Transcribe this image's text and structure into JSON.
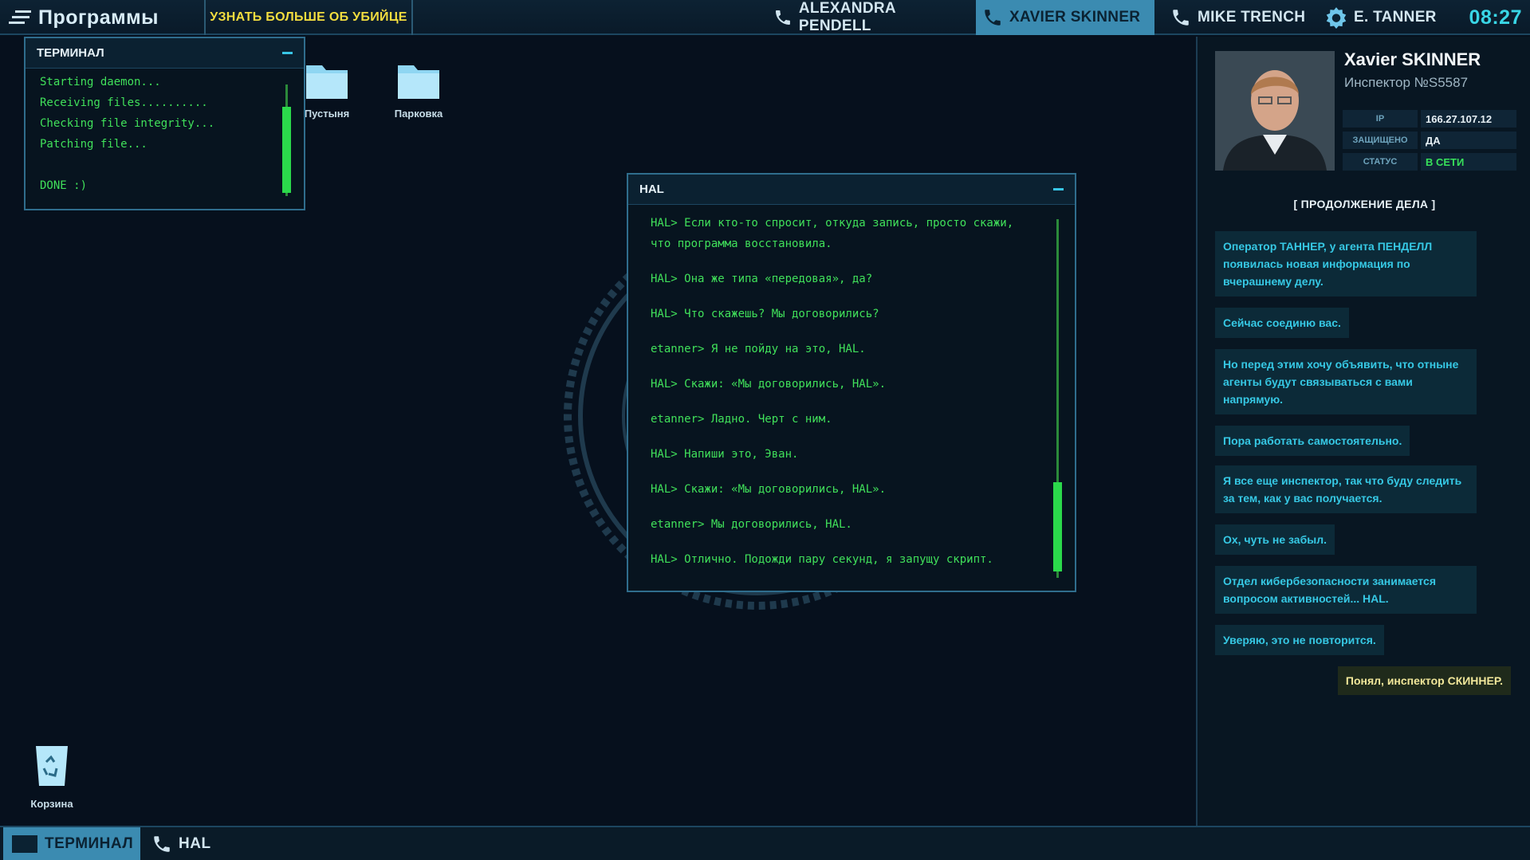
{
  "topbar": {
    "programs_label": "Программы",
    "learn_button": "УЗНАТЬ БОЛЬШЕ ОБ УБИЙЦЕ",
    "contacts": [
      {
        "name": "ALEXANDRA PENDELL",
        "icon": "phone-icon",
        "active": false
      },
      {
        "name": "XAVIER SKINNER",
        "icon": "phone-icon",
        "active": true
      },
      {
        "name": "MIKE TRENCH",
        "icon": "phone-icon",
        "active": false
      },
      {
        "name": "E. TANNER",
        "icon": "badge-icon",
        "active": false
      }
    ],
    "clock": "08:27"
  },
  "desktop": {
    "folders": [
      "Пустыня",
      "Парковка"
    ],
    "recycle_bin_label": "Корзина"
  },
  "terminal": {
    "title": "ТЕРМИНАЛ",
    "lines": [
      "Starting daemon...",
      "Receiving files..........",
      "Checking file integrity...",
      "Patching file...",
      "",
      "DONE :)"
    ]
  },
  "hal": {
    "title": "HAL",
    "messages": [
      "HAL> Если кто-то спросит, откуда запись, просто скажи, что программа восстановила.",
      "HAL> Она же типа «передовая», да?",
      "HAL> Что скажешь? Мы договорились?",
      "etanner> Я не пойду на это, HAL.",
      "HAL> Скажи: «Мы договорились, HAL».",
      "etanner> Ладно. Черт с ним.",
      "HAL> Напиши это, Эван.",
      "HAL> Скажи: «Мы договорились, HAL».",
      "etanner> Мы договорились, HAL.",
      "HAL> Отлично. Подожди пару секунд, я запущу скрипт."
    ]
  },
  "profile": {
    "name": "Xavier SKINNER",
    "rank": "Инспектор №S5587",
    "ip_label": "IP",
    "ip_value": "166.27.107.12",
    "secure_label": "ЗАЩИЩЕНО",
    "secure_value": "ДА",
    "status_label": "СТАТУС",
    "status_value": "В СЕТИ",
    "case_header": "[   ПРОДОЛЖЕНИЕ ДЕЛА   ]",
    "chat": [
      "Оператор ТАННЕР, у агента ПЕНДЕЛЛ появилась новая информация по вчерашнему делу.",
      "Сейчас соединю вас.",
      "Но перед этим хочу объявить, что отныне агенты будут связываться с вами напрямую.",
      "Пора работать самостоятельно.",
      "Я все еще инспектор, так что буду следить за тем, как у вас получается.",
      "Ох, чуть не забыл.",
      "Отдел кибербезопасности занимается вопросом активностей... HAL.",
      "Уверяю, это не повторится."
    ],
    "reply": "Понял, инспектор СКИННЕР."
  },
  "taskbar": {
    "items": [
      {
        "label": "ТЕРМИНАЛ",
        "icon": "terminal-icon",
        "active": true
      },
      {
        "label": "HAL",
        "icon": "phone-icon",
        "active": false
      }
    ]
  },
  "colors": {
    "accent": "#3b8bb1",
    "terminal_green": "#40e05a",
    "chat_text": "#36c8e4",
    "highlight": "#f2dd3f"
  }
}
